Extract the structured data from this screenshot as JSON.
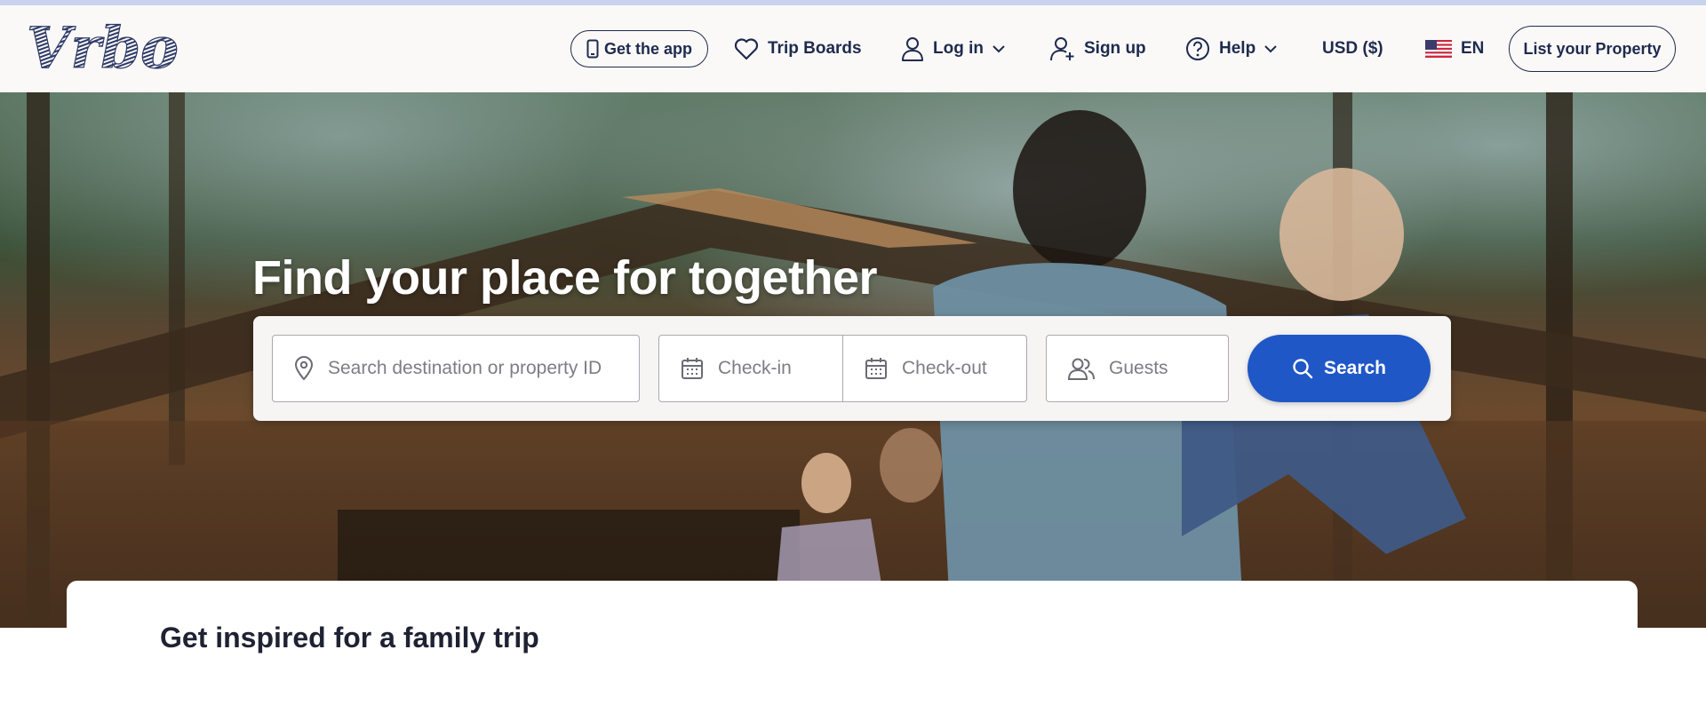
{
  "header": {
    "logo_text": "Vrbo",
    "get_app_label": "Get the app",
    "trip_boards_label": "Trip Boards",
    "login_label": "Log in",
    "signup_label": "Sign up",
    "help_label": "Help",
    "currency_label": "USD ($)",
    "language_label": "EN",
    "list_property_label": "List your Property",
    "icons": [
      "phone-icon",
      "heart-icon",
      "user-icon",
      "add-user-icon",
      "help-circle-icon",
      "chevron-down-icon",
      "us-flag-icon"
    ]
  },
  "hero": {
    "title": "Find your place for together"
  },
  "search": {
    "destination_placeholder": "Search destination or property ID",
    "checkin_placeholder": "Check-in",
    "checkout_placeholder": "Check-out",
    "guests_placeholder": "Guests",
    "button_label": "Search",
    "accent_color": "#1f57c6"
  },
  "inspiration": {
    "heading": "Get inspired for a family trip"
  },
  "colors": {
    "brand_navy": "#1e2b4f",
    "header_bg": "#fbf9f7"
  }
}
